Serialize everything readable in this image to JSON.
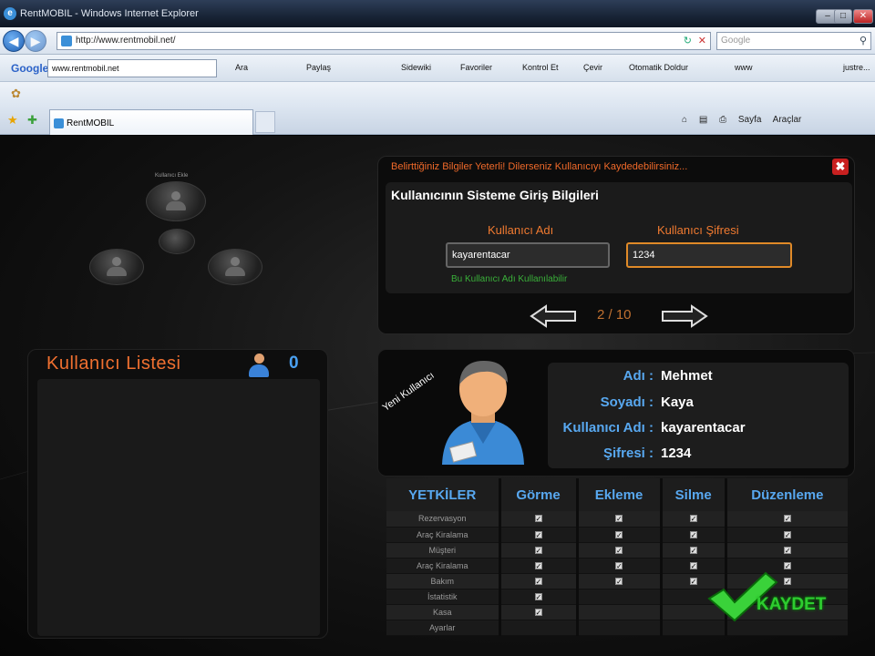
{
  "window": {
    "title": "RentMOBIL - Windows Internet Explorer"
  },
  "address": {
    "url": "http://www.rentmobil.net/",
    "search_placeholder": "Google"
  },
  "googlebar": {
    "logo": "Google",
    "search_value": "www.rentmobil.net",
    "items": [
      "Ara",
      "Paylaş",
      "Sidewiki",
      "Favoriler",
      "Kontrol Et",
      "Çevir",
      "Otomatik Doldur",
      "www",
      "justre..."
    ]
  },
  "tab": {
    "label": "RentMOBIL"
  },
  "commandbar": {
    "page": "Sayfa",
    "tools": "Araçlar"
  },
  "app": {
    "message": "Belirttiğiniz Bilgiler Yeterli! Dilerseniz Kullanıcıyı Kaydedebilirsiniz...",
    "login_title": "Kullanıcının Sisteme Giriş Bilgileri",
    "username_label": "Kullanıcı Adı",
    "password_label": "Kullanıcı Şifresi",
    "username_value": "kayarentacar",
    "password_value": "1234",
    "username_ok": "Bu Kullanıcı Adı Kullanılabilir",
    "pager": "2 / 10",
    "user_circle_label": "Kullanıcı Ekle",
    "list_title": "Kullanıcı Listesi",
    "list_count": "0",
    "new_user_label": "Yeni Kullanıcı",
    "info": [
      {
        "label": "Adı :",
        "value": "Mehmet"
      },
      {
        "label": "Soyadı :",
        "value": "Kaya"
      },
      {
        "label": "Kullanıcı Adı :",
        "value": "kayarentacar"
      },
      {
        "label": "Şifresi :",
        "value": "1234"
      }
    ],
    "permissions": {
      "headers": [
        "YETKİLER",
        "Görme",
        "Ekleme",
        "Silme",
        "Düzenleme"
      ],
      "rows": [
        {
          "name": "Rezervasyon",
          "checks": [
            true,
            true,
            true,
            true
          ]
        },
        {
          "name": "Araç Kiralama",
          "checks": [
            true,
            true,
            true,
            true
          ]
        },
        {
          "name": "Müşteri",
          "checks": [
            true,
            true,
            true,
            true
          ]
        },
        {
          "name": "Araç Kiralama",
          "checks": [
            true,
            true,
            true,
            true
          ]
        },
        {
          "name": "Bakım",
          "checks": [
            true,
            true,
            true,
            true
          ]
        },
        {
          "name": "İstatistik",
          "checks": [
            true,
            false,
            false,
            false
          ]
        },
        {
          "name": "Kasa",
          "checks": [
            true,
            false,
            false,
            false
          ]
        },
        {
          "name": "Ayarlar",
          "checks": [
            false,
            false,
            false,
            false
          ]
        }
      ]
    },
    "save_label": "KAYDET"
  }
}
